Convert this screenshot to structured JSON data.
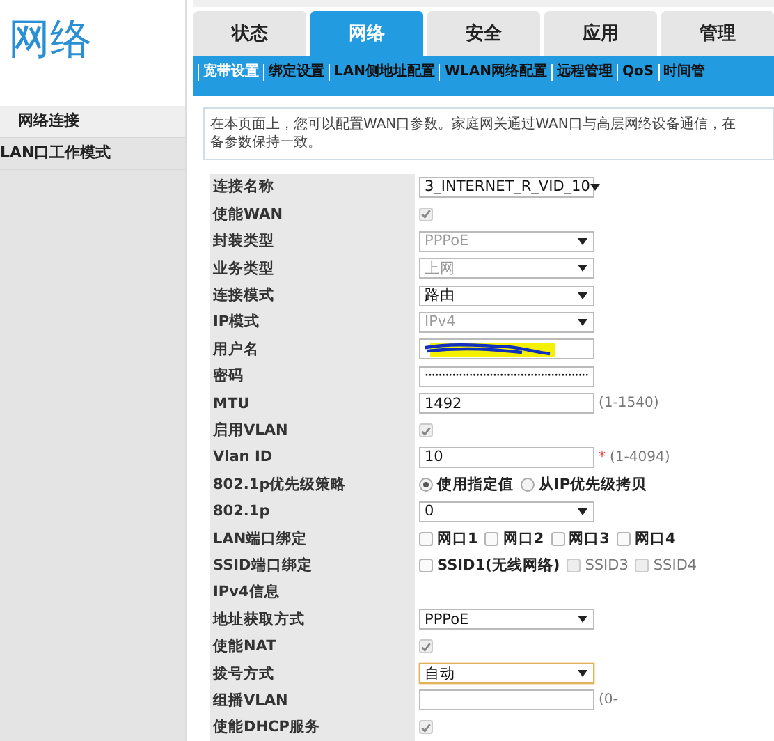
{
  "sidebar": {
    "title": "网络",
    "items": [
      {
        "label": "网络连接",
        "selected": true
      },
      {
        "label": "LAN口工作模式",
        "selected": false
      }
    ]
  },
  "tabs": [
    {
      "label": "状态",
      "selected": false
    },
    {
      "label": "网络",
      "selected": true
    },
    {
      "label": "安全",
      "selected": false
    },
    {
      "label": "应用",
      "selected": false
    },
    {
      "label": "管理",
      "selected": false
    }
  ],
  "subnav": [
    {
      "label": "宽带设置",
      "selected": true
    },
    {
      "label": "绑定设置",
      "selected": false
    },
    {
      "label": "LAN侧地址配置",
      "selected": false
    },
    {
      "label": "WLAN网络配置",
      "selected": false
    },
    {
      "label": "远程管理",
      "selected": false
    },
    {
      "label": "QoS",
      "selected": false
    },
    {
      "label": "时间管",
      "selected": false
    }
  ],
  "notice": [
    "在本页面上，您可以配置WAN口参数。家庭网关通过WAN口与高层网络设备通信，在",
    "备参数保持一致。"
  ],
  "form": {
    "rows": [
      {
        "kind": "select",
        "label": "连接名称",
        "value": "3_INTERNET_R_VID_10",
        "disabled": false
      },
      {
        "kind": "checkbox",
        "label": "使能WAN",
        "checked": true,
        "disabled": true
      },
      {
        "kind": "select",
        "label": "封装类型",
        "value": "PPPoE",
        "disabled": true
      },
      {
        "kind": "select",
        "label": "业务类型",
        "value": "上网",
        "disabled": true
      },
      {
        "kind": "select",
        "label": "连接模式",
        "value": "路由",
        "disabled": false
      },
      {
        "kind": "select",
        "label": "IP模式",
        "value": "IPv4",
        "disabled": true
      },
      {
        "kind": "redacted",
        "label": "用户名"
      },
      {
        "kind": "text",
        "label": "密码",
        "value": "••••••••••••••••••••••••••••••••••••••••••••••••"
      },
      {
        "kind": "text",
        "label": "MTU",
        "value": "1492",
        "hint": "(1-1540)"
      },
      {
        "kind": "checkbox",
        "label": "启用VLAN",
        "checked": true,
        "disabled": true
      },
      {
        "kind": "text",
        "label": "Vlan ID",
        "value": "10",
        "required": "*",
        "hint": "(1-4094)"
      },
      {
        "kind": "radio",
        "label": "802.1p优先级策略",
        "options": [
          {
            "label": "使用指定值",
            "selected": true
          },
          {
            "label": "从IP优先级拷贝",
            "selected": false
          }
        ]
      },
      {
        "kind": "select",
        "label": "802.1p",
        "value": "0",
        "disabled": false
      },
      {
        "kind": "checks",
        "label": "LAN端口绑定",
        "options": [
          {
            "label": "网口1",
            "checked": false,
            "disabled": false
          },
          {
            "label": "网口2",
            "checked": false,
            "disabled": false
          },
          {
            "label": "网口3",
            "checked": false,
            "disabled": false
          },
          {
            "label": "网口4",
            "checked": false,
            "disabled": false
          }
        ]
      },
      {
        "kind": "checks",
        "label": "SSID端口绑定",
        "options": [
          {
            "label": "SSID1(无线网络)",
            "checked": false,
            "disabled": false
          },
          {
            "label": "SSID3",
            "checked": false,
            "disabled": true
          },
          {
            "label": "SSID4",
            "checked": false,
            "disabled": true
          }
        ]
      },
      {
        "kind": "section",
        "label": "IPv4信息"
      },
      {
        "kind": "select",
        "label": "地址获取方式",
        "value": "PPPoE",
        "disabled": false
      },
      {
        "kind": "checkbox",
        "label": "使能NAT",
        "checked": true,
        "disabled": true
      },
      {
        "kind": "select",
        "label": "拨号方式",
        "value": "自动",
        "disabled": false,
        "focused": true
      },
      {
        "kind": "text",
        "label": "组播VLAN",
        "value": "",
        "hint": "(0-"
      },
      {
        "kind": "checkbox",
        "label": "使能DHCP服务",
        "checked": true,
        "disabled": true
      }
    ]
  }
}
